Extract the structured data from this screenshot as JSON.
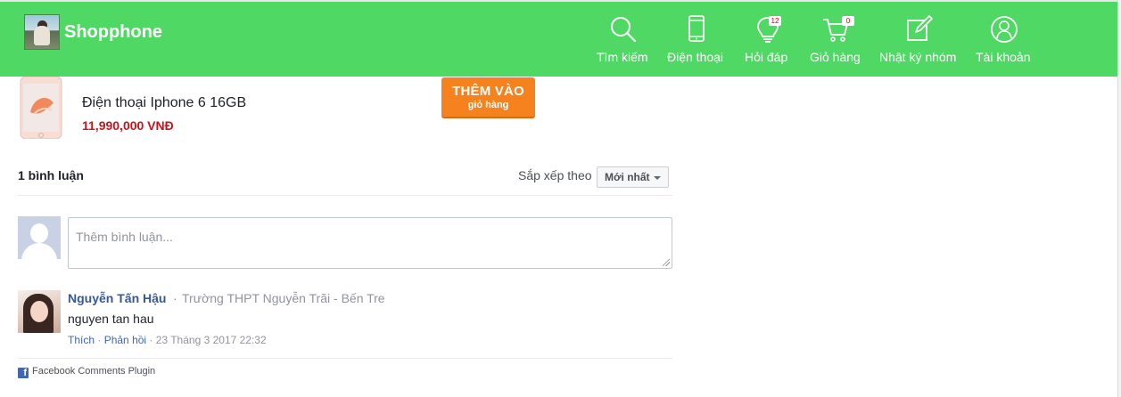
{
  "brand": {
    "name": "Shopphone"
  },
  "nav": {
    "search": "Tìm kiếm",
    "phones": "Điện thoại",
    "qa": "Hỏi đáp",
    "qa_badge": "12",
    "cart": "Giỏ hàng",
    "cart_badge": "0",
    "diary": "Nhật ký nhóm",
    "account": "Tài khoản"
  },
  "product": {
    "name": "Điện thoại Iphone 6 16GB",
    "price": "11,990,000 VNĐ",
    "add_button": {
      "line1": "THÊM VÀO",
      "line2": "giỏ hàng"
    }
  },
  "comments": {
    "count_label": "1 bình luận",
    "sort_label": "Sắp xếp theo",
    "sort_value": "Mới nhất",
    "input_placeholder": "Thêm bình luận...",
    "items": [
      {
        "author": "Nguyễn Tấn Hậu",
        "separator": "·",
        "school": "Trường THPT Nguyễn Trãi - Bến Tre",
        "text": "nguyen tan hau",
        "like": "Thích",
        "reply": "Phản hồi",
        "date": "23 Tháng 3 2017 22:32"
      }
    ],
    "plugin_label": "Facebook Comments Plugin"
  },
  "colors": {
    "header": "#4fd964",
    "accent_button": "#f5821f",
    "price": "#c4161c",
    "link": "#365899"
  }
}
